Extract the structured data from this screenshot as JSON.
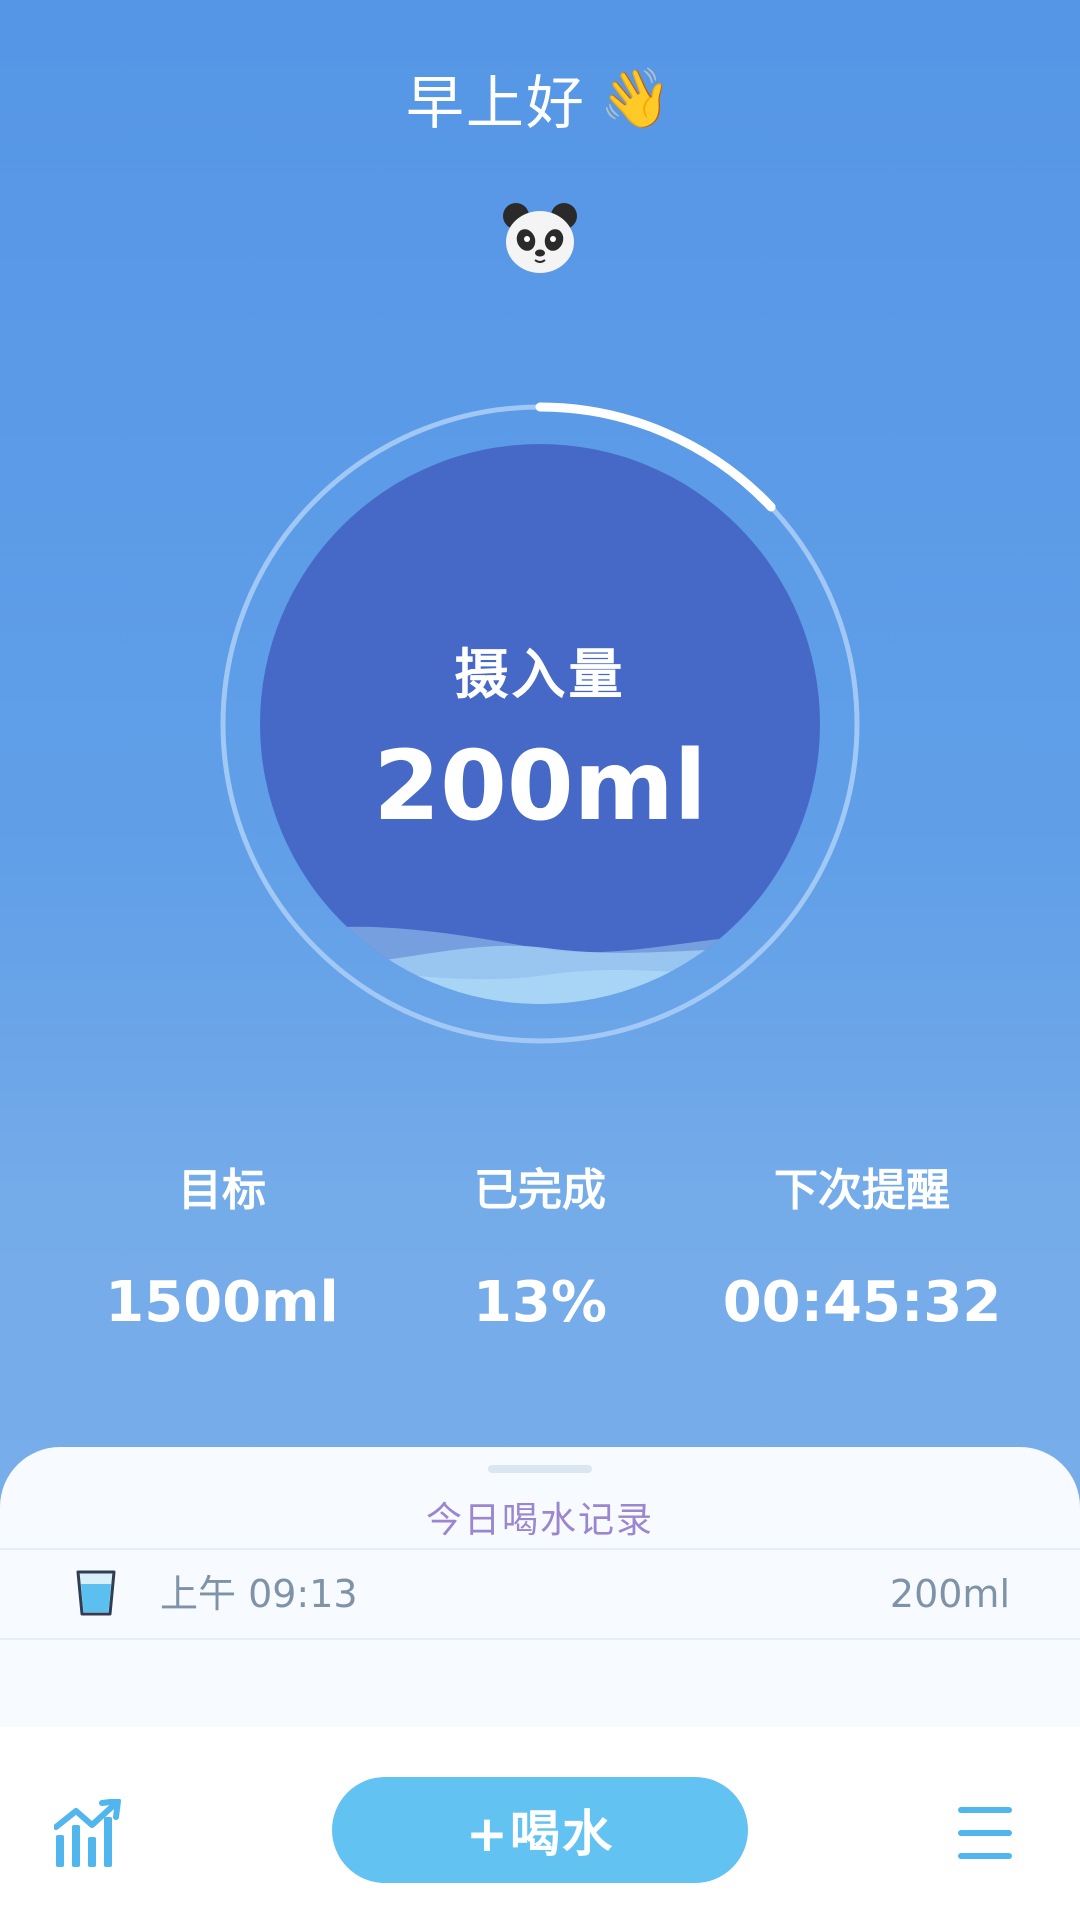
{
  "header": {
    "greeting": "早上好",
    "wave_emoji": "👋",
    "avatar_icon": "panda-icon"
  },
  "intake": {
    "label": "摄入量",
    "value": "200ml",
    "progress_fraction": 0.13
  },
  "stats": [
    {
      "label": "目标",
      "value": "1500ml"
    },
    {
      "label": "已完成",
      "value": "13%"
    },
    {
      "label": "下次提醒",
      "value": "00:45:32"
    }
  ],
  "records": {
    "title": "今日喝水记录",
    "items": [
      {
        "time": "上午 09:13",
        "amount": "200ml",
        "icon": "cup-icon"
      }
    ]
  },
  "bottom_bar": {
    "chart_icon": "chart-icon",
    "drink_button_label": "+喝水",
    "menu_icon": "menu-icon"
  },
  "colors": {
    "background_top": "#5596e6",
    "inner_circle": "#4669c7",
    "accent_button": "#62c3f2",
    "record_title": "#9b86cf",
    "record_text": "#7f93a8"
  }
}
